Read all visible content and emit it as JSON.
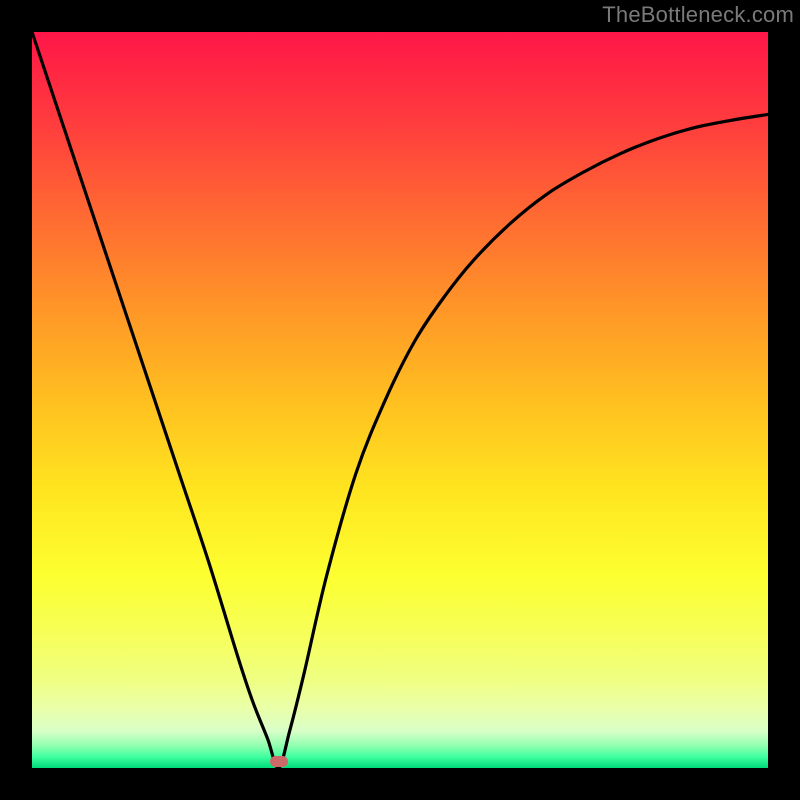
{
  "watermark": "TheBottleneck.com",
  "marker": {
    "color": "#cc6a6a",
    "x_fraction": 0.335,
    "y_fraction": 0.992
  },
  "chart_data": {
    "type": "line",
    "title": "",
    "xlabel": "",
    "ylabel": "",
    "xlim": [
      0,
      1
    ],
    "ylim": [
      0,
      1
    ],
    "grid": false,
    "legend": false,
    "background": "red-yellow-green vertical gradient",
    "series": [
      {
        "name": "bottleneck-curve",
        "color": "#000000",
        "x": [
          0.0,
          0.04,
          0.08,
          0.12,
          0.16,
          0.2,
          0.24,
          0.28,
          0.3,
          0.32,
          0.335,
          0.35,
          0.37,
          0.4,
          0.44,
          0.48,
          0.52,
          0.56,
          0.6,
          0.65,
          0.7,
          0.75,
          0.8,
          0.85,
          0.9,
          0.95,
          1.0
        ],
        "y": [
          1.0,
          0.88,
          0.76,
          0.64,
          0.52,
          0.4,
          0.28,
          0.15,
          0.09,
          0.04,
          0.0,
          0.05,
          0.13,
          0.26,
          0.4,
          0.5,
          0.58,
          0.64,
          0.69,
          0.74,
          0.78,
          0.81,
          0.835,
          0.855,
          0.87,
          0.88,
          0.888
        ]
      }
    ],
    "annotations": [
      {
        "type": "marker",
        "shape": "pill",
        "color": "#cc6a6a",
        "x": 0.335,
        "y": 0.005
      }
    ]
  }
}
